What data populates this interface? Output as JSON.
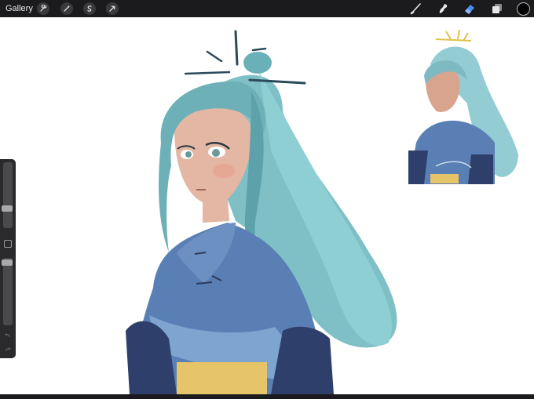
{
  "toolbar": {
    "gallery_label": "Gallery",
    "left_tools": [
      "wrench-icon",
      "magic-wand-icon",
      "selection-icon",
      "transform-icon"
    ],
    "right_tools": [
      "brush-icon",
      "smudge-icon",
      "eraser-icon",
      "layers-icon"
    ],
    "active_tool": "eraser-icon",
    "current_color": "#000000",
    "accent": "#4a8df0"
  },
  "sidebar": {
    "brush_size_level": 0.27,
    "opacity_level": 0.3
  },
  "canvas": {
    "background": "#ffffff"
  }
}
